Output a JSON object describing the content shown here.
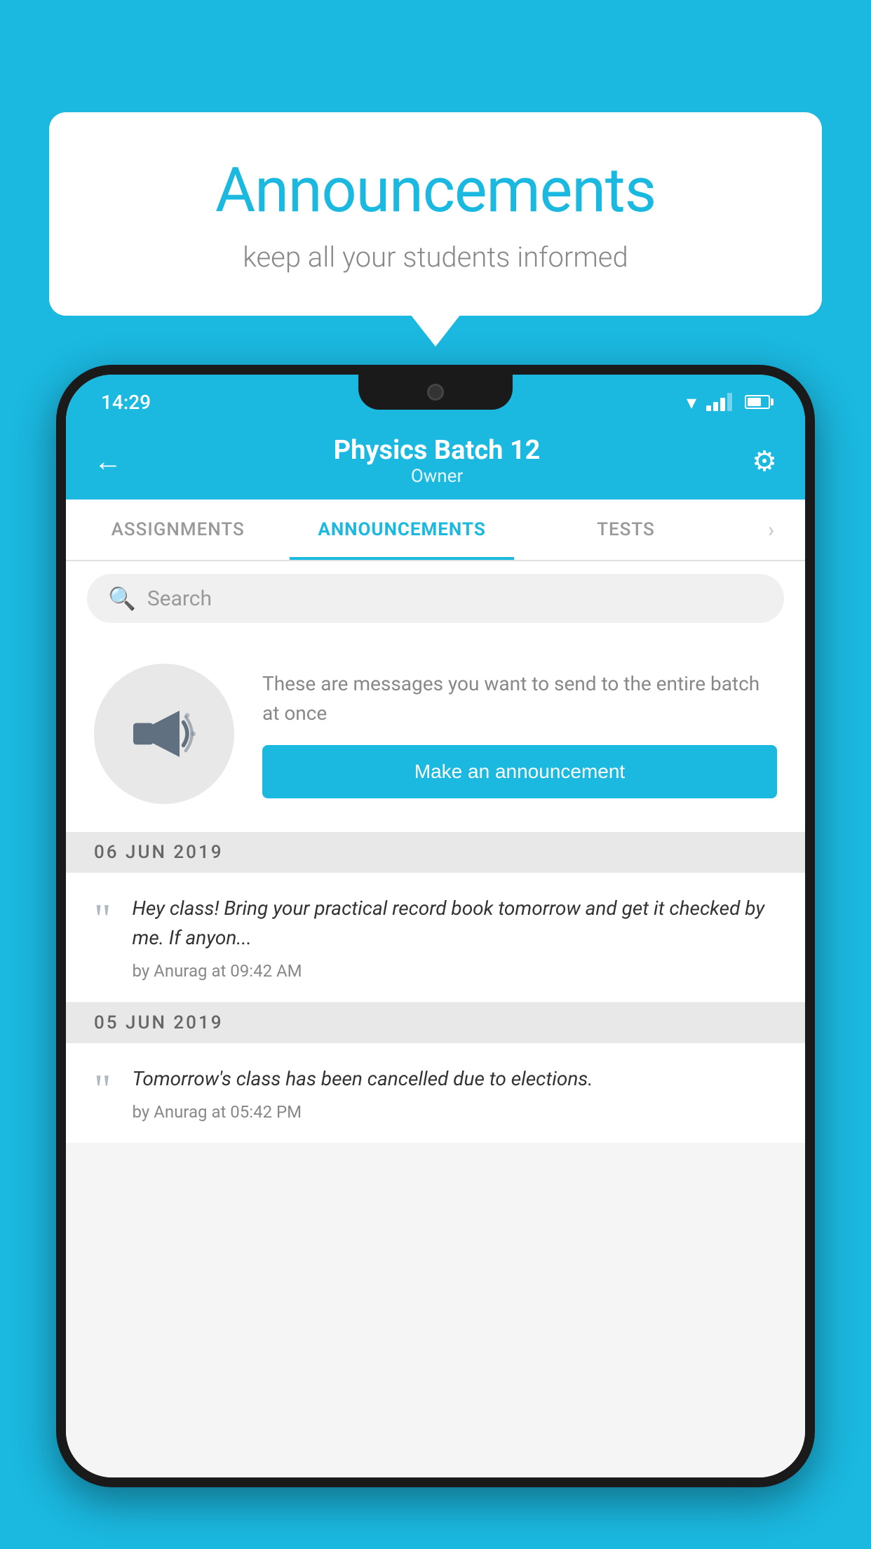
{
  "background_color": "#1BB8E0",
  "speech_bubble": {
    "title": "Announcements",
    "subtitle": "keep all your students informed"
  },
  "status_bar": {
    "time": "14:29"
  },
  "app_header": {
    "title": "Physics Batch 12",
    "subtitle": "Owner",
    "back_label": "←",
    "settings_label": "⚙"
  },
  "tabs": [
    {
      "label": "ASSIGNMENTS",
      "active": false
    },
    {
      "label": "ANNOUNCEMENTS",
      "active": true
    },
    {
      "label": "TESTS",
      "active": false
    },
    {
      "label": "›",
      "active": false
    }
  ],
  "search": {
    "placeholder": "Search"
  },
  "promo_card": {
    "description_text": "These are messages you want to send to the entire batch at once",
    "button_label": "Make an announcement"
  },
  "announcements": [
    {
      "date": "06  JUN  2019",
      "text": "Hey class! Bring your practical record book tomorrow and get it checked by me. If anyon...",
      "meta": "by Anurag at 09:42 AM"
    },
    {
      "date": "05  JUN  2019",
      "text": "Tomorrow's class has been cancelled due to elections.",
      "meta": "by Anurag at 05:42 PM"
    }
  ]
}
